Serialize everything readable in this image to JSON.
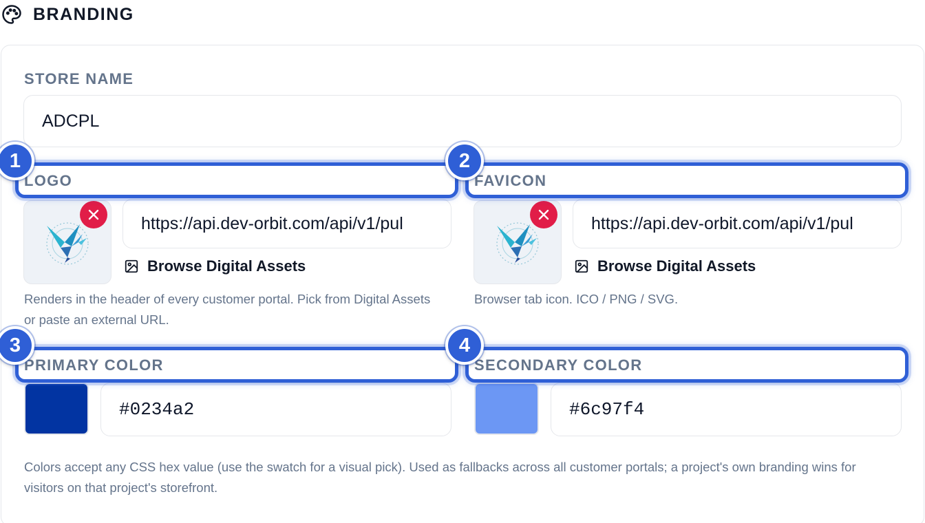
{
  "section": {
    "title": "BRANDING",
    "icon": "palette-icon"
  },
  "store_name": {
    "label": "STORE NAME",
    "value": "ADCPL"
  },
  "logo": {
    "label": "LOGO",
    "url": "https://api.dev-orbit.com/api/v1/pul",
    "browse_label": "Browse Digital Assets",
    "help": "Renders in the header of every customer portal. Pick from Digital Assets or paste an external URL."
  },
  "favicon": {
    "label": "FAVICON",
    "url": "https://api.dev-orbit.com/api/v1/pul",
    "browse_label": "Browse Digital Assets",
    "help": "Browser tab icon. ICO / PNG / SVG."
  },
  "primary_color": {
    "label": "PRIMARY COLOR",
    "value": "#0234a2",
    "swatch": "#0234a2"
  },
  "secondary_color": {
    "label": "SECONDARY COLOR",
    "value": "#6c97f4",
    "swatch": "#6c97f4"
  },
  "colors_help": "Colors accept any CSS hex value (use the swatch for a visual pick). Used as fallbacks across all customer portals; a project's own branding wins for visitors on that project's storefront.",
  "annotations": [
    "1",
    "2",
    "3",
    "4"
  ],
  "colors": {
    "highlight": "#2f5fd6",
    "remove": "#e11d48",
    "label": "#64748b"
  }
}
